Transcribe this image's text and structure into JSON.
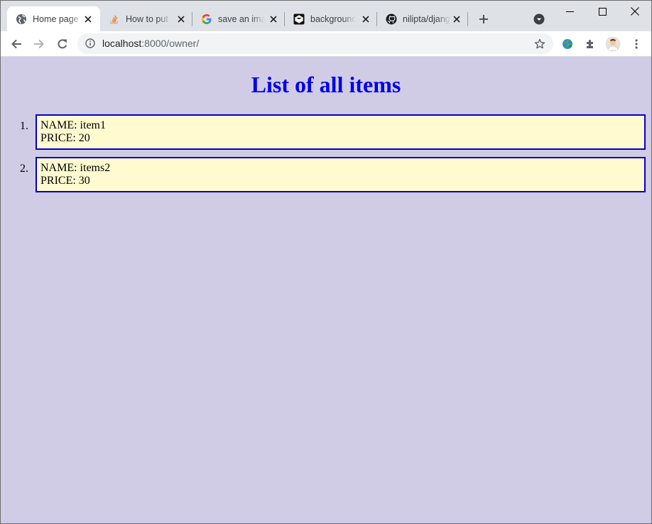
{
  "browser": {
    "tabs": [
      {
        "title": "Home page",
        "favicon": "globe-icon",
        "active": true
      },
      {
        "title": "How to put c",
        "favicon": "stackoverflow-icon",
        "active": false
      },
      {
        "title": "save an imag",
        "favicon": "google-icon",
        "active": false
      },
      {
        "title": "background",
        "favicon": "codepen-icon",
        "active": false
      },
      {
        "title": "nilipta/djang",
        "favicon": "github-icon",
        "active": false
      }
    ],
    "url_host": "localhost",
    "url_path": ":8000/owner/"
  },
  "page": {
    "heading": "List of all items",
    "items": [
      {
        "number": "1.",
        "name_line": "NAME: item1",
        "price_line": "PRICE: 20"
      },
      {
        "number": "2.",
        "name_line": "NAME: items2",
        "price_line": "PRICE: 30"
      }
    ]
  },
  "colors": {
    "page_background": "#d0cce6",
    "heading": "#0000ee",
    "item_border": "#0000cc",
    "item_background": "#fffad0"
  }
}
